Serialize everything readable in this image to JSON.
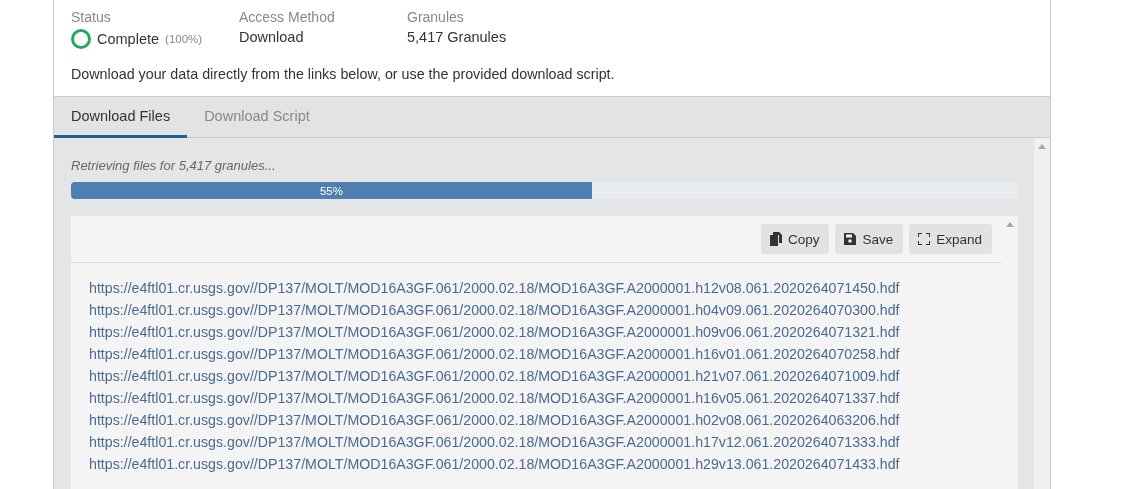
{
  "summary": {
    "fields": [
      {
        "label": "Status",
        "value": "Complete",
        "note": "(100%)",
        "kind": "status"
      },
      {
        "label": "Access Method",
        "value": "Download",
        "kind": "text"
      },
      {
        "label": "Granules",
        "value": "5,417 Granules",
        "kind": "text"
      }
    ],
    "description": "Download your data directly from the links below, or use the provided download script."
  },
  "tabs": [
    {
      "label": "Download Files",
      "selected": true
    },
    {
      "label": "Download Script",
      "selected": false
    }
  ],
  "progress": {
    "message": "Retrieving files for 5,417 granules...",
    "level": 0.55,
    "reading": "55%"
  },
  "toolbar": [
    {
      "label": "Copy",
      "kind": "copy"
    },
    {
      "label": "Save",
      "kind": "save"
    },
    {
      "label": "Expand",
      "kind": "expand"
    }
  ],
  "links": [
    "https://e4ftl01.cr.usgs.gov//DP137/MOLT/MOD16A3GF.061/2000.02.18/MOD16A3GF.A2000001.h12v08.061.2020264071450.hdf",
    "https://e4ftl01.cr.usgs.gov//DP137/MOLT/MOD16A3GF.061/2000.02.18/MOD16A3GF.A2000001.h04v09.061.2020264070300.hdf",
    "https://e4ftl01.cr.usgs.gov//DP137/MOLT/MOD16A3GF.061/2000.02.18/MOD16A3GF.A2000001.h09v06.061.2020264071321.hdf",
    "https://e4ftl01.cr.usgs.gov//DP137/MOLT/MOD16A3GF.061/2000.02.18/MOD16A3GF.A2000001.h16v01.061.2020264070258.hdf",
    "https://e4ftl01.cr.usgs.gov//DP137/MOLT/MOD16A3GF.061/2000.02.18/MOD16A3GF.A2000001.h21v07.061.2020264071009.hdf",
    "https://e4ftl01.cr.usgs.gov//DP137/MOLT/MOD16A3GF.061/2000.02.18/MOD16A3GF.A2000001.h16v05.061.2020264071337.hdf",
    "https://e4ftl01.cr.usgs.gov//DP137/MOLT/MOD16A3GF.061/2000.02.18/MOD16A3GF.A2000001.h02v08.061.2020264063206.hdf",
    "https://e4ftl01.cr.usgs.gov//DP137/MOLT/MOD16A3GF.061/2000.02.18/MOD16A3GF.A2000001.h17v12.061.2020264071333.hdf",
    "https://e4ftl01.cr.usgs.gov//DP137/MOLT/MOD16A3GF.061/2000.02.18/MOD16A3GF.A2000001.h29v13.061.2020264071433.hdf"
  ]
}
